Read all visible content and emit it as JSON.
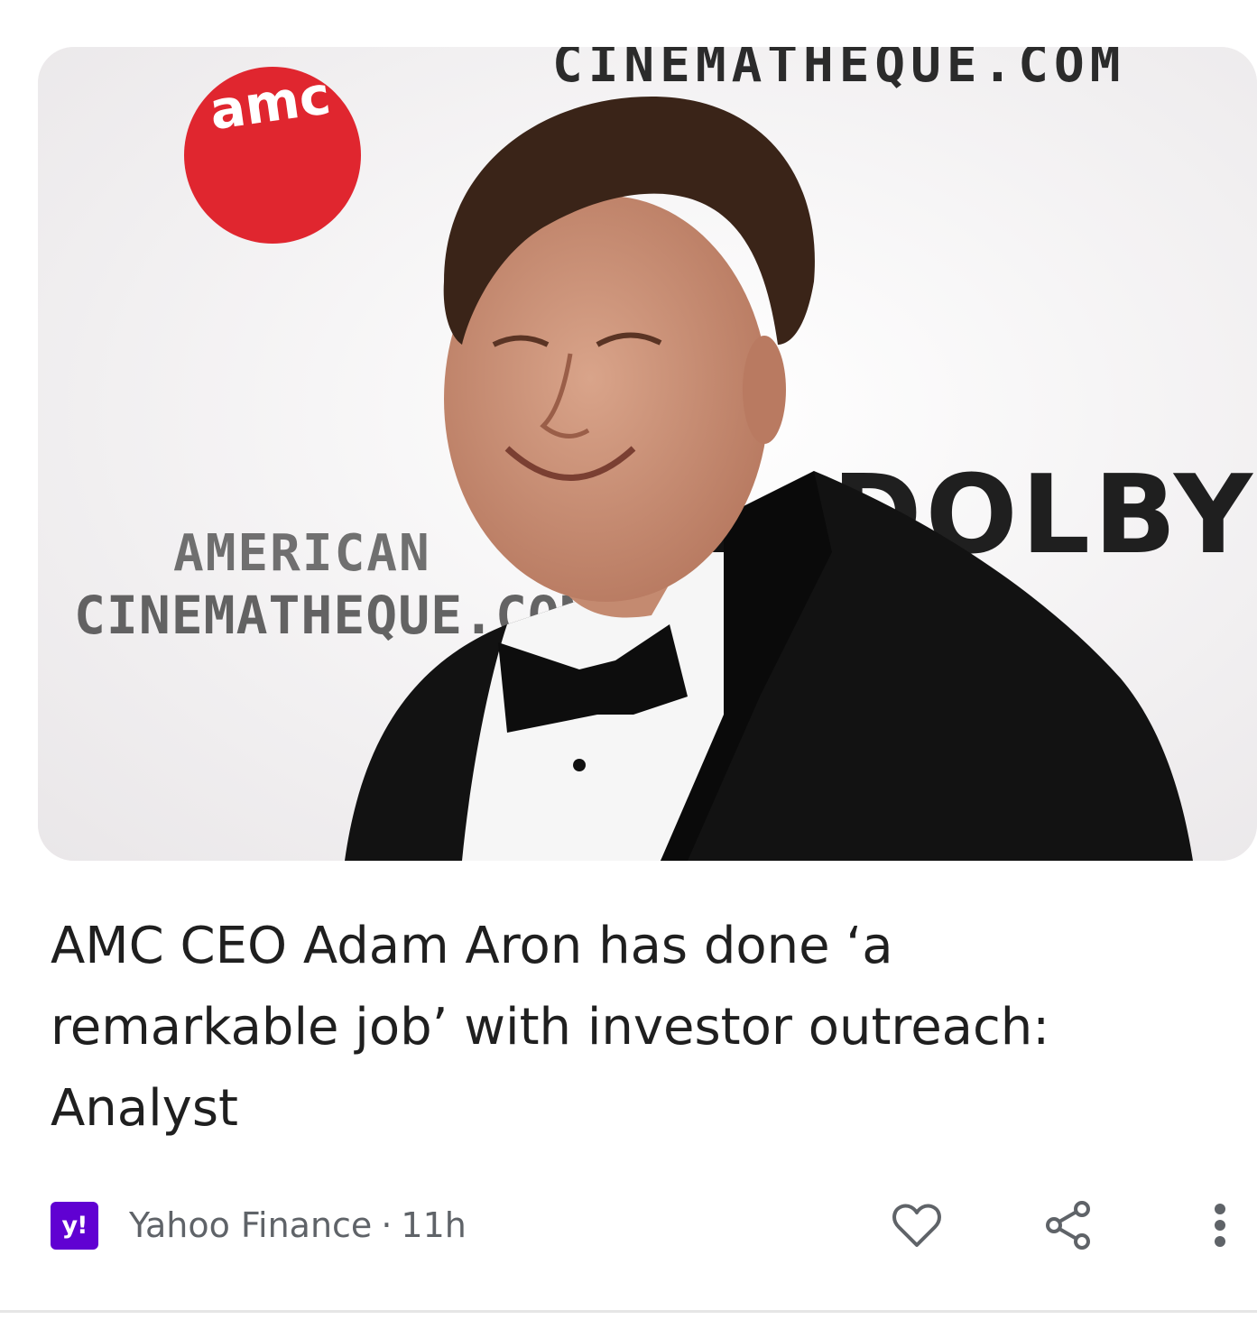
{
  "article": {
    "headline": "AMC CEO Adam Aron has done ‘a remarkable job’ with investor outreach: Analyst",
    "image": {
      "backdrop_logo_text": "amc",
      "backdrop_top_text": "CINEMATHEQUE.COM",
      "backdrop_left_line1": "AMERICAN",
      "backdrop_left_line2": "CINEMATHEQUE.COM",
      "backdrop_right_text": "DOLBY"
    },
    "publisher": {
      "logo_text": "y!",
      "name": "Yahoo Finance",
      "separator": "·",
      "age": "11h",
      "brand_color": "#6001d2"
    }
  },
  "actions": {
    "like_icon": "heart-icon",
    "share_icon": "share-icon",
    "more_icon": "more-vertical-icon"
  },
  "colors": {
    "amc_red": "#e0262f",
    "text_primary": "#1f1f1f",
    "text_secondary": "#5f6368"
  }
}
